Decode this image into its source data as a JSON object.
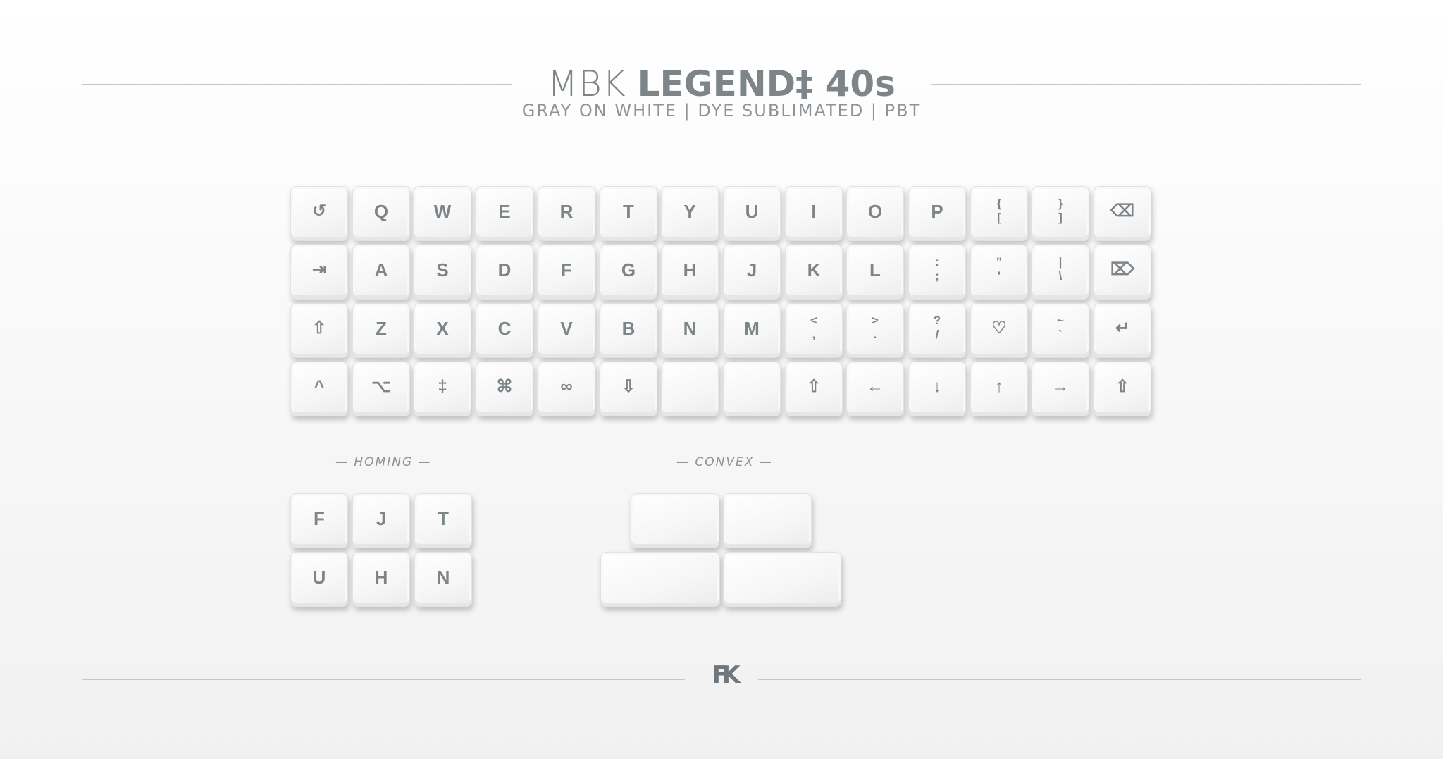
{
  "header": {
    "title_light": "MBK",
    "title_bold": "LEGEND‡ 40s",
    "subtitle": "GRAY ON WHITE | DYE SUBLIMATED | PBT"
  },
  "keyboard": {
    "rows": [
      [
        {
          "label": "↺",
          "icon": "undo-icon"
        },
        {
          "label": "Q"
        },
        {
          "label": "W"
        },
        {
          "label": "E"
        },
        {
          "label": "R"
        },
        {
          "label": "T"
        },
        {
          "label": "Y"
        },
        {
          "label": "U"
        },
        {
          "label": "I"
        },
        {
          "label": "O"
        },
        {
          "label": "P"
        },
        {
          "top": "{",
          "bottom": "["
        },
        {
          "top": "}",
          "bottom": "]"
        },
        {
          "label": "⌫",
          "icon": "backspace-icon"
        }
      ],
      [
        {
          "label": "⇥",
          "icon": "tab-icon"
        },
        {
          "label": "A"
        },
        {
          "label": "S"
        },
        {
          "label": "D"
        },
        {
          "label": "F"
        },
        {
          "label": "G"
        },
        {
          "label": "H"
        },
        {
          "label": "J"
        },
        {
          "label": "K"
        },
        {
          "label": "L"
        },
        {
          "top": ":",
          "bottom": ";"
        },
        {
          "top": "\"",
          "bottom": "'"
        },
        {
          "top": "|",
          "bottom": "\\"
        },
        {
          "label": "⌦",
          "icon": "forward-delete-icon"
        }
      ],
      [
        {
          "label": "⇧",
          "icon": "shift-icon"
        },
        {
          "label": "Z"
        },
        {
          "label": "X"
        },
        {
          "label": "C"
        },
        {
          "label": "V"
        },
        {
          "label": "B"
        },
        {
          "label": "N"
        },
        {
          "label": "M"
        },
        {
          "top": "<",
          "bottom": ","
        },
        {
          "top": ">",
          "bottom": "."
        },
        {
          "top": "?",
          "bottom": "/"
        },
        {
          "label": "♡",
          "icon": "heart-icon"
        },
        {
          "top": "~",
          "bottom": "`"
        },
        {
          "label": "↵",
          "icon": "return-icon"
        }
      ],
      [
        {
          "label": "^",
          "icon": "control-icon"
        },
        {
          "label": "⌥",
          "icon": "option-icon"
        },
        {
          "label": "‡",
          "icon": "double-dagger-icon"
        },
        {
          "label": "⌘",
          "icon": "command-icon"
        },
        {
          "label": "∞",
          "icon": "infinity-icon"
        },
        {
          "label": "⇩",
          "icon": "lower-layer-icon"
        },
        {
          "label": ""
        },
        {
          "label": ""
        },
        {
          "label": "⇧",
          "icon": "raise-layer-icon"
        },
        {
          "label": "←",
          "icon": "arrow-left-icon"
        },
        {
          "label": "↓",
          "icon": "arrow-down-icon"
        },
        {
          "label": "↑",
          "icon": "arrow-up-icon"
        },
        {
          "label": "→",
          "icon": "arrow-right-icon"
        },
        {
          "label": "⇧",
          "icon": "shift-icon"
        }
      ]
    ]
  },
  "homing": {
    "label": "— HOMING —",
    "keys": [
      "F",
      "J",
      "T",
      "U",
      "H",
      "N"
    ]
  },
  "convex": {
    "label": "— CONVEX —"
  },
  "footer": {
    "logo_text": "FK",
    "logo_icon": "fk-logo-icon"
  },
  "colors": {
    "legend": "#7d8589",
    "rule": "#c4c8cb",
    "keycap": "#ffffff",
    "background": "#f7f7f7"
  }
}
